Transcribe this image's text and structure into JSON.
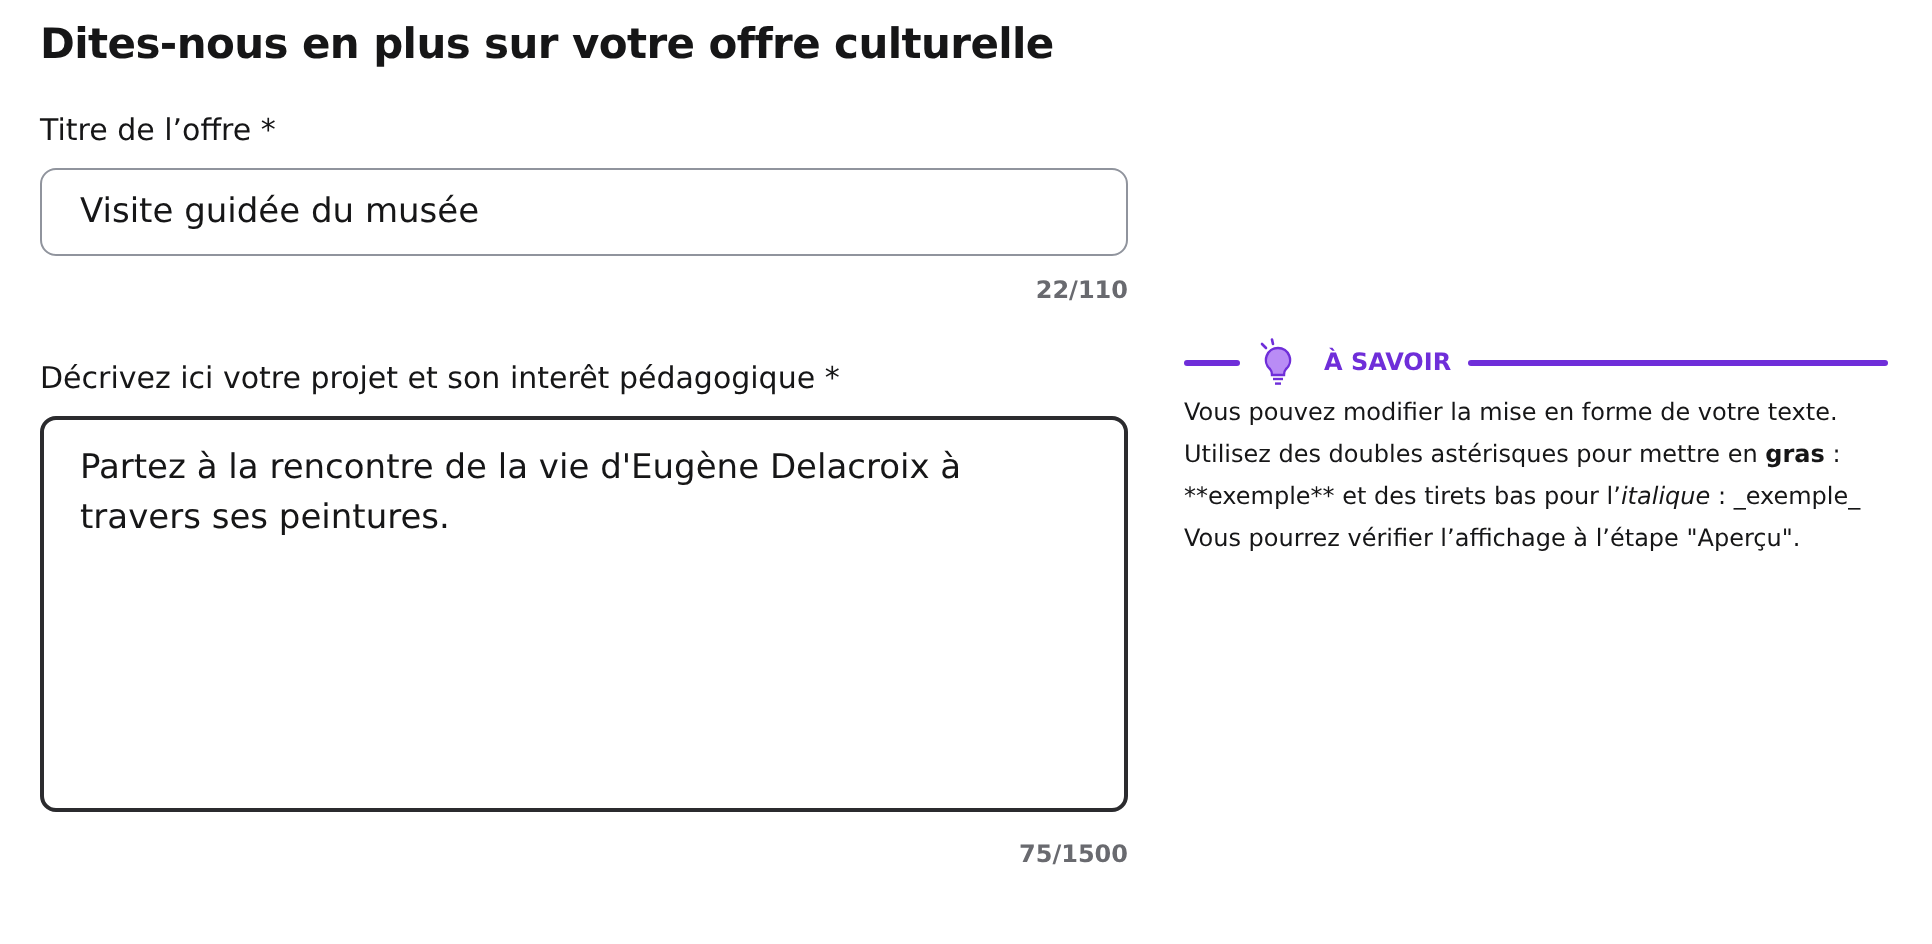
{
  "heading": "Dites-nous en plus sur votre offre culturelle",
  "fields": [
    {
      "kind": "input",
      "label": "Titre de l’offre *",
      "value": "Visite guidée du musée",
      "counter": "22/110",
      "focused": false
    },
    {
      "kind": "textarea",
      "label": "Décrivez ici votre projet et son interêt pédagogique *",
      "value": "Partez à la rencontre de la vie d'Eugène Delacroix à travers ses peintures.",
      "counter": "75/1500",
      "focused": true
    }
  ],
  "info": {
    "title": "À SAVOIR",
    "paragraphs": [
      [
        {
          "kind": "plain",
          "text": "Vous pouvez modifier la mise en forme de votre texte."
        }
      ],
      [
        {
          "kind": "plain",
          "text": "Utilisez des doubles astérisques pour mettre en "
        },
        {
          "kind": "bold",
          "text": "gras"
        },
        {
          "kind": "plain",
          "text": " : **exemple** et des tirets bas pour l’"
        },
        {
          "kind": "italic",
          "text": "italique"
        },
        {
          "kind": "plain",
          "text": " : _exemple_"
        }
      ],
      [
        {
          "kind": "plain",
          "text": "Vous pourrez vérifier l’affichage à l’étape \"Aperçu\"."
        }
      ]
    ]
  }
}
